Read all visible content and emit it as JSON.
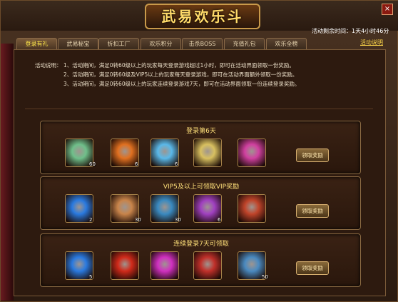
{
  "window": {
    "title": "武易欢乐斗",
    "close_glyph": "×",
    "remain_label": "活动剩余时间：",
    "remain_value": "1天4小时46分",
    "help_link": "活动说明"
  },
  "tabs": [
    {
      "label": "登录有礼",
      "active": true
    },
    {
      "label": "武易秘宝"
    },
    {
      "label": "折扣工厂"
    },
    {
      "label": "欢乐积分"
    },
    {
      "label": "击杀BOSS"
    },
    {
      "label": "充值礼包"
    },
    {
      "label": "欢乐全榜"
    }
  ],
  "description": {
    "label": "活动说明：",
    "lines": [
      "1、活动期间，满足0转60级以上的玩家每天登录游戏超过1小时，即可在活动界面领取一份奖励。",
      "2、活动期间，满足0转60级及VIP5以上的玩家每天登录游戏，即可在活动界面额外领取一份奖励。",
      "3、活动期间，满足0转60级以上的玩家连续登录游戏7天，即可在活动界面领取一份连续登录奖励。"
    ]
  },
  "sections": [
    {
      "title": "登录第6天",
      "button": "领取奖励",
      "items": [
        {
          "icon": "gem-ring-icon",
          "color": "#6fbf8a",
          "count": "60"
        },
        {
          "icon": "fire-orb-icon",
          "color": "#e07020",
          "count": "6"
        },
        {
          "icon": "blue-orb-icon",
          "color": "#5ab8e8",
          "count": "6"
        },
        {
          "icon": "gold-ingot-icon",
          "color": "#d8c060",
          "count": ""
        },
        {
          "icon": "pink-orb-icon",
          "color": "#d040a0",
          "count": ""
        }
      ]
    },
    {
      "title": "VIP5及以上可领取VIP奖励",
      "button": "领取奖励",
      "items": [
        {
          "icon": "star-cluster-icon",
          "color": "#2a7ae0",
          "count": "2"
        },
        {
          "icon": "sack-icon",
          "color": "#c8844a",
          "count": "30"
        },
        {
          "icon": "ring-icon",
          "color": "#3a8ac0",
          "count": "30"
        },
        {
          "icon": "purple-orb-icon",
          "color": "#a040c0",
          "count": "6"
        },
        {
          "icon": "chest-icon",
          "color": "#c0442a",
          "count": ""
        }
      ]
    },
    {
      "title": "连续登录7天可领取",
      "button": "领取奖励",
      "items": [
        {
          "icon": "star-cluster-icon",
          "color": "#2a7ae0",
          "count": "5"
        },
        {
          "icon": "red-orb-icon",
          "color": "#d02a1a",
          "count": ""
        },
        {
          "icon": "magenta-orb-icon",
          "color": "#d030c0",
          "count": ""
        },
        {
          "icon": "treasure-chest-icon",
          "color": "#c0302a",
          "count": ""
        },
        {
          "icon": "scroll-tool-icon",
          "color": "#4a8ac0",
          "count": "50"
        }
      ]
    }
  ]
}
